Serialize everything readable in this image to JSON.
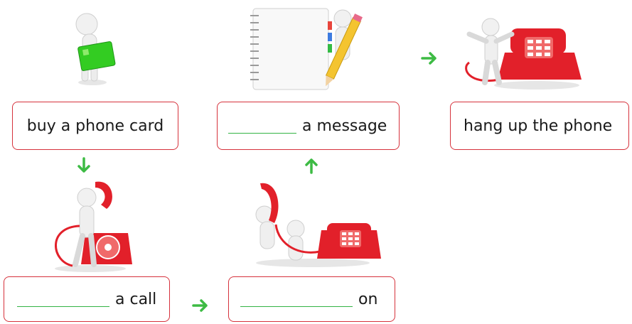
{
  "colors": {
    "card_border": "#d6323c",
    "arrow": "#3dbb44",
    "blank_line": "#33b344",
    "phone_red": "#e2202a"
  },
  "steps": [
    {
      "text": "buy a phone card",
      "icon": "person-with-phone-card-icon"
    },
    {
      "text": "a call",
      "icon": "person-dialing-phone-icon"
    },
    {
      "text": "on",
      "icon": "person-holding-on-phone-icon"
    },
    {
      "text": "a message",
      "icon": "notebook-and-pencil-icon"
    },
    {
      "text": "hang up the phone",
      "icon": "person-hanging-up-phone-icon"
    }
  ]
}
